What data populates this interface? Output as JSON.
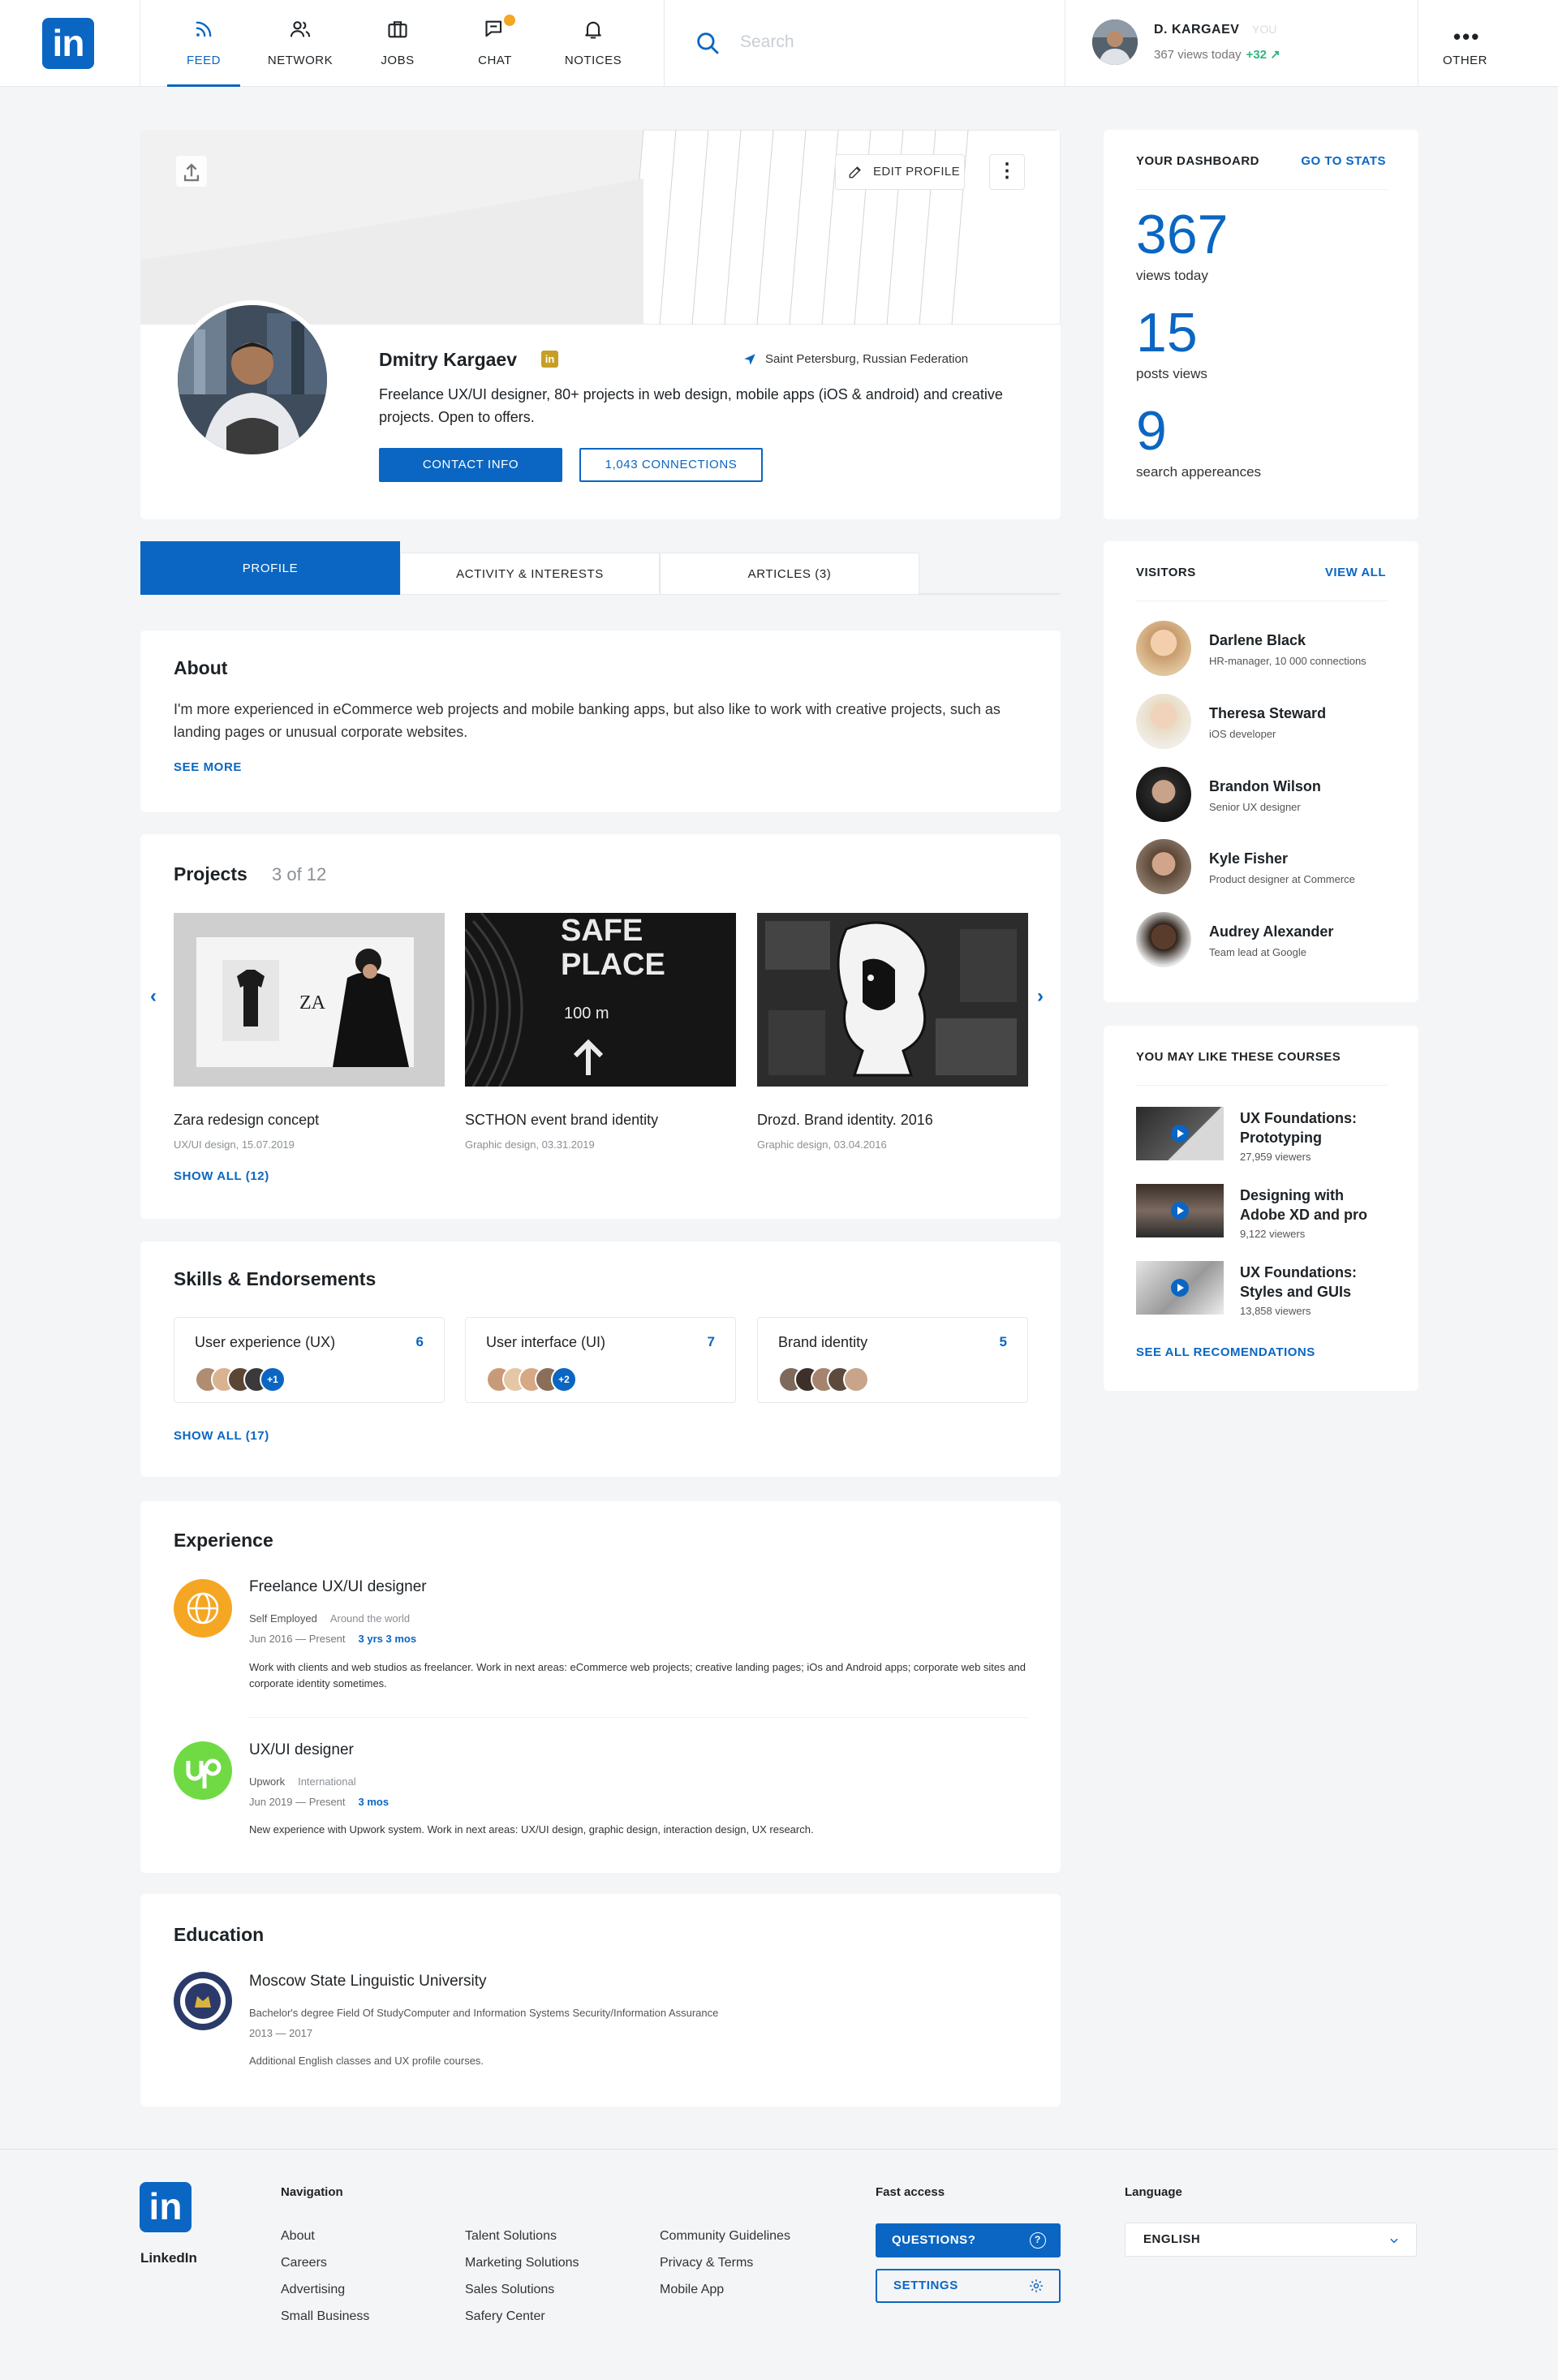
{
  "nav": {
    "items": [
      {
        "label": "FEED",
        "icon": "rss-icon"
      },
      {
        "label": "NETWORK",
        "icon": "people-icon"
      },
      {
        "label": "JOBS",
        "icon": "briefcase-icon"
      },
      {
        "label": "CHAT",
        "icon": "chat-icon"
      },
      {
        "label": "NOTICES",
        "icon": "bell-icon"
      }
    ],
    "search_placeholder": "Search",
    "user_name": "D. KARGAEV",
    "user_tag": "YOU",
    "user_views": "367 views today",
    "user_delta": "+32 ↗",
    "other_label": "OTHER"
  },
  "profile": {
    "edit_label": "EDIT PROFILE",
    "name": "Dmitry Kargaev",
    "badge": "in",
    "location": "Saint Petersburg, Russian Federation",
    "headline": "Freelance UX/UI designer, 80+ projects in web design, mobile apps  (iOS & android) and creative projects. Open to offers.",
    "contact_label": "CONTACT INFO",
    "connections_label": "1,043 CONNECTIONS"
  },
  "tabs": [
    "PROFILE",
    "ACTIVITY & INTERESTS",
    "ARTICLES (3)"
  ],
  "about": {
    "title": "About",
    "text": "I'm more experienced in eCommerce web projects and mobile banking apps, but also like to work with creative projects, such as landing pages or unusual corporate websites.",
    "see_more": "SEE MORE"
  },
  "projects": {
    "title": "Projects",
    "count": "3 of 12",
    "items": [
      {
        "title": "Zara redesign concept",
        "meta": "UX/UI design, 15.07.2019"
      },
      {
        "title": "SCTHON event brand identity",
        "meta": "Graphic design, 03.31.2019"
      },
      {
        "title": "Drozd. Brand identity. 2016",
        "meta": "Graphic design, 03.04.2016"
      }
    ],
    "show_all": "SHOW ALL (12)",
    "img2_line1": "SAFE",
    "img2_line2": "PLACE",
    "img2_line3": "100 m",
    "img1_logo": "ZA"
  },
  "skills": {
    "title": "Skills & Endorsements",
    "items": [
      {
        "name": "User experience (UX)",
        "count": "6",
        "more": "+1"
      },
      {
        "name": "User interface (UI)",
        "count": "7",
        "more": "+2"
      },
      {
        "name": "Brand identity",
        "count": "5",
        "more": ""
      }
    ],
    "show_all": "SHOW ALL (17)"
  },
  "experience": {
    "title": "Experience",
    "items": [
      {
        "role": "Freelance UX/UI designer",
        "company": "Self Employed",
        "place": "Around the world",
        "dates": "Jun 2016 — Present",
        "duration": "3 yrs 3 mos",
        "desc": "Work with clients and web studios as freelancer.  Work in next areas: eCommerce web projects; creative landing pages; iOs and Android apps; corporate web sites and corporate identity sometimes."
      },
      {
        "role": "UX/UI designer",
        "company": "Upwork",
        "place": "International",
        "dates": "Jun 2019 — Present",
        "duration": "3 mos",
        "desc": "New experience with Upwork system. Work in next areas: UX/UI design, graphic design, interaction design, UX research."
      }
    ]
  },
  "education": {
    "title": "Education",
    "school": "Moscow State Linguistic University",
    "degree": "Bachelor's degree Field Of StudyComputer and Information Systems Security/Information Assurance",
    "years": "2013 — 2017",
    "note": "Additional English classes and UX profile courses."
  },
  "dashboard": {
    "title": "YOUR DASHBOARD",
    "link": "GO TO STATS",
    "stats": [
      {
        "value": "367",
        "label": "views today"
      },
      {
        "value": "15",
        "label": "posts views"
      },
      {
        "value": "9",
        "label": "search appereances"
      }
    ]
  },
  "visitors": {
    "title": "VISITORS",
    "link": "VIEW ALL",
    "items": [
      {
        "name": "Darlene Black",
        "sub": "HR-manager, 10 000 connections"
      },
      {
        "name": "Theresa Steward",
        "sub": "iOS developer"
      },
      {
        "name": "Brandon Wilson",
        "sub": "Senior UX designer"
      },
      {
        "name": "Kyle Fisher",
        "sub": "Product designer at Commerce"
      },
      {
        "name": "Audrey Alexander",
        "sub": "Team lead at Google"
      }
    ]
  },
  "courses": {
    "title": "YOU MAY LIKE THESE COURSES",
    "items": [
      {
        "title": "UX Foundations: Prototyping",
        "views": "27,959 viewers"
      },
      {
        "title": "Designing with Adobe XD and pro",
        "views": "9,122 viewers"
      },
      {
        "title": "UX Foundations: Styles and GUIs",
        "views": "13,858 viewers"
      }
    ],
    "link": "SEE ALL RECOMENDATIONS"
  },
  "footer": {
    "brand": "LinkedIn",
    "nav_title": "Navigation",
    "col1": [
      "About",
      "Careers",
      "Advertising",
      "Small Business"
    ],
    "col2": [
      "Talent Solutions",
      "Marketing Solutions",
      "Sales Solutions",
      "Safery Center"
    ],
    "col3": [
      "Community Guidelines",
      "Privacy & Terms",
      "Mobile App"
    ],
    "fast_title": "Fast access",
    "questions": "QUESTIONS?",
    "settings": "SETTINGS",
    "lang_title": "Language",
    "lang_value": "ENGLISH"
  },
  "colors": {
    "accent": "#0a66c2",
    "badge_gold": "#c79f27",
    "positive": "#2eb67d",
    "notice_dot": "#f5a623"
  }
}
